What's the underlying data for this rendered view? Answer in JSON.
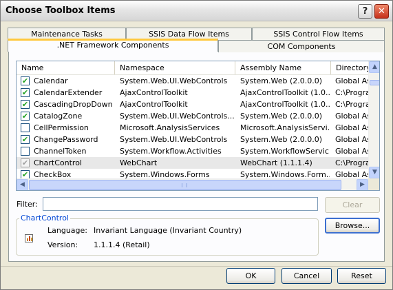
{
  "window": {
    "title": "Choose Toolbox Items",
    "help_glyph": "?",
    "close_glyph": "✕"
  },
  "tabs": {
    "back_row": [
      "Maintenance Tasks",
      "SSIS Data Flow Items",
      "SSIS Control Flow Items"
    ],
    "front_row": [
      ".NET Framework Components",
      "COM Components"
    ],
    "active": ".NET Framework Components"
  },
  "list": {
    "columns": [
      "Name",
      "Namespace",
      "Assembly Name",
      "Directory"
    ],
    "rows": [
      {
        "checked": true,
        "name": "Calendar",
        "namespace": "System.Web.UI.WebControls",
        "assembly": "System.Web (2.0.0.0)",
        "directory": "Global Ass"
      },
      {
        "checked": true,
        "name": "CalendarExtender",
        "namespace": "AjaxControlToolkit",
        "assembly": "AjaxControlToolkit (1.0....",
        "directory": "C:\\Progra"
      },
      {
        "checked": true,
        "name": "CascadingDropDown",
        "namespace": "AjaxControlToolkit",
        "assembly": "AjaxControlToolkit (1.0....",
        "directory": "C:\\Progra"
      },
      {
        "checked": true,
        "name": "CatalogZone",
        "namespace": "System.Web.UI.WebControls.....",
        "assembly": "System.Web (2.0.0.0)",
        "directory": "Global Ass"
      },
      {
        "checked": false,
        "name": "CellPermission",
        "namespace": "Microsoft.AnalysisServices",
        "assembly": "Microsoft.AnalysisServi...",
        "directory": "Global Ass"
      },
      {
        "checked": true,
        "name": "ChangePassword",
        "namespace": "System.Web.UI.WebControls",
        "assembly": "System.Web (2.0.0.0)",
        "directory": "Global Ass"
      },
      {
        "checked": false,
        "name": "ChannelToken",
        "namespace": "System.Workflow.Activities",
        "assembly": "System.WorkflowServic...",
        "directory": "Global Ass"
      },
      {
        "checked": true,
        "name": "ChartControl",
        "namespace": "WebChart",
        "assembly": "WebChart (1.1.1.4)",
        "directory": "C:\\Progra",
        "selected": true,
        "disabled": true
      },
      {
        "checked": true,
        "name": "CheckBox",
        "namespace": "System.Windows.Forms",
        "assembly": "System.Windows.Form...",
        "directory": "Global Ass"
      }
    ]
  },
  "filter": {
    "label": "Filter:",
    "value": "",
    "clear_label": "Clear"
  },
  "browse_label": "Browse...",
  "details": {
    "title": "ChartControl",
    "language_label": "Language:",
    "language_value": "Invariant Language (Invariant Country)",
    "version_label": "Version:",
    "version_value": "1.1.1.4 (Retail)"
  },
  "buttons": {
    "ok": "OK",
    "cancel": "Cancel",
    "reset": "Reset"
  }
}
